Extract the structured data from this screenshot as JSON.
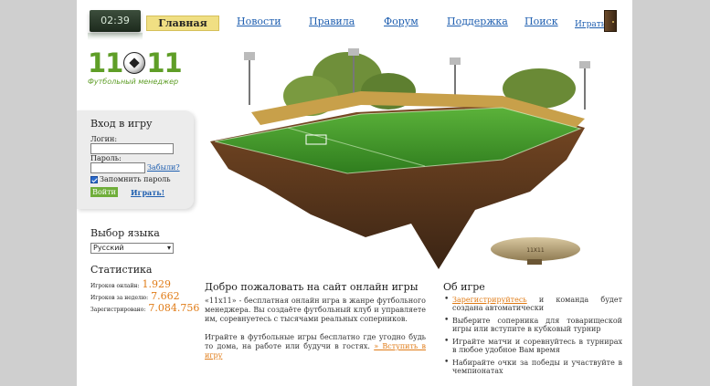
{
  "clock": "02:39",
  "nav": {
    "items": [
      {
        "label": "Главная",
        "active": true
      },
      {
        "label": "Новости"
      },
      {
        "label": "Правила"
      },
      {
        "label": "Форум"
      },
      {
        "label": "Поддержка"
      },
      {
        "label": "Поиск"
      }
    ],
    "play_label": "Играть!"
  },
  "logo": {
    "num_left": "11",
    "num_right": "11",
    "subtitle": "Футбольный менеджер"
  },
  "login": {
    "title": "Вход в игру",
    "login_label": "Логин:",
    "password_label": "Пароль:",
    "forgot": "Забыли?",
    "remember": "Запомнить пароль",
    "submit": "Войти",
    "play": "Играть!"
  },
  "language": {
    "title": "Выбор языка",
    "selected": "Русский"
  },
  "stats": {
    "title": "Статистика",
    "rows": [
      {
        "label": "Игроков онлайн:",
        "value": "1.929"
      },
      {
        "label": "Игроков за неделю:",
        "value": "7.662"
      },
      {
        "label": "Зарегистрировано:",
        "value": "7.084.756"
      }
    ]
  },
  "airship_label": "11X11",
  "welcome": {
    "title": "Добро пожаловать на сайт онлайн игры",
    "p1": "«11x11» - бесплатная онлайн игра в жанре футбольного менеджера. Вы создаёте футбольный клуб и управляете им, соревнуетесь с тысячами реальных соперников.",
    "p2": "Играйте в футбольные игры бесплатно где угодно будь то дома, на работе или будучи в гостях.",
    "p2_link": "» Вступить в игру"
  },
  "about": {
    "title": "Об игре",
    "items": [
      {
        "link": "Зарегистрируйтесь",
        "text": " и команда будет создана автоматически"
      },
      {
        "text": "Выберите соперника для товарищеской игры или вступите в кубковый турнир"
      },
      {
        "text": "Играйте матчи и соревнуйтесь в турнирах в любое удобное Вам время"
      },
      {
        "text": "Набирайте очки за победы и участвуйте в чемпионатах"
      }
    ]
  },
  "colors": {
    "accent_green": "#5f9e27",
    "link_blue": "#1f5fb0",
    "orange": "#e07b16",
    "nav_active": "#f0df83"
  }
}
